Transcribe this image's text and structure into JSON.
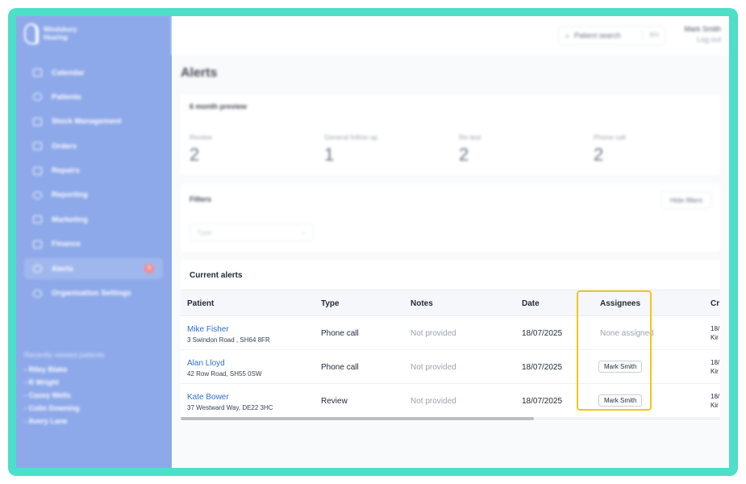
{
  "brand": {
    "name_line1": "Windsbury",
    "name_line2": "Hearing"
  },
  "sidebar": {
    "items": [
      {
        "label": "Calendar",
        "icon": "calendar-icon"
      },
      {
        "label": "Patients",
        "icon": "user-icon"
      },
      {
        "label": "Stock Management",
        "icon": "box-icon"
      },
      {
        "label": "Orders",
        "icon": "clipboard-icon"
      },
      {
        "label": "Repairs",
        "icon": "wrench-icon"
      },
      {
        "label": "Reporting",
        "icon": "pie-chart-icon"
      },
      {
        "label": "Marketing",
        "icon": "mail-icon"
      },
      {
        "label": "Finance",
        "icon": "card-icon"
      },
      {
        "label": "Alerts",
        "icon": "bell-icon",
        "badge": "3",
        "active": true
      },
      {
        "label": "Organisation Settings",
        "icon": "gear-icon"
      }
    ],
    "recent_title": "Recently viewed patients",
    "recent": [
      "- Riley Blake",
      "- R Wright",
      "- Casey Wells",
      "- Colin Downing",
      "- Avery Lane"
    ]
  },
  "topbar": {
    "search_placeholder": "Patient search",
    "search_shortcut": "⌘K",
    "user_name": "Mark Smith",
    "logout": "Log out"
  },
  "page": {
    "title": "Alerts"
  },
  "preview": {
    "title": "6 month preview",
    "stats": [
      {
        "label": "Review",
        "value": "2"
      },
      {
        "label": "General follow up",
        "value": "1"
      },
      {
        "label": "Re-test",
        "value": "2"
      },
      {
        "label": "Phone call",
        "value": "2"
      }
    ]
  },
  "filters": {
    "title": "Filters",
    "hide_label": "Hide filters",
    "type_placeholder": "Type"
  },
  "alerts": {
    "title": "Current alerts",
    "columns": [
      "Patient",
      "Type",
      "Notes",
      "Date",
      "Assignees",
      "Cr"
    ],
    "rows": [
      {
        "name": "Mike Fisher",
        "address": "3 Swindon Road , SH64 8FR",
        "type": "Phone call",
        "notes": "Not provided",
        "date": "18/07/2025",
        "assignee": "None assigned",
        "assigned": false,
        "cr1": "18/",
        "cr2": "Kir"
      },
      {
        "name": "Alan Lloyd",
        "address": "42 Row Road, SH55 0SW",
        "type": "Phone call",
        "notes": "Not provided",
        "date": "18/07/2025",
        "assignee": "Mark Smith",
        "assigned": true,
        "cr1": "18/",
        "cr2": "Kir"
      },
      {
        "name": "Kate Bower",
        "address": "37 Westward Way, DE22 3HC",
        "type": "Review",
        "notes": "Not provided",
        "date": "18/07/2025",
        "assignee": "Mark Smith",
        "assigned": true,
        "cr1": "18/",
        "cr2": "Kir"
      }
    ]
  },
  "colors": {
    "frame": "#4ddfc8",
    "sidebar": "#8ea9ea",
    "link": "#2f6fd6",
    "highlight": "#f5c518",
    "badge": "#f58a8a"
  }
}
